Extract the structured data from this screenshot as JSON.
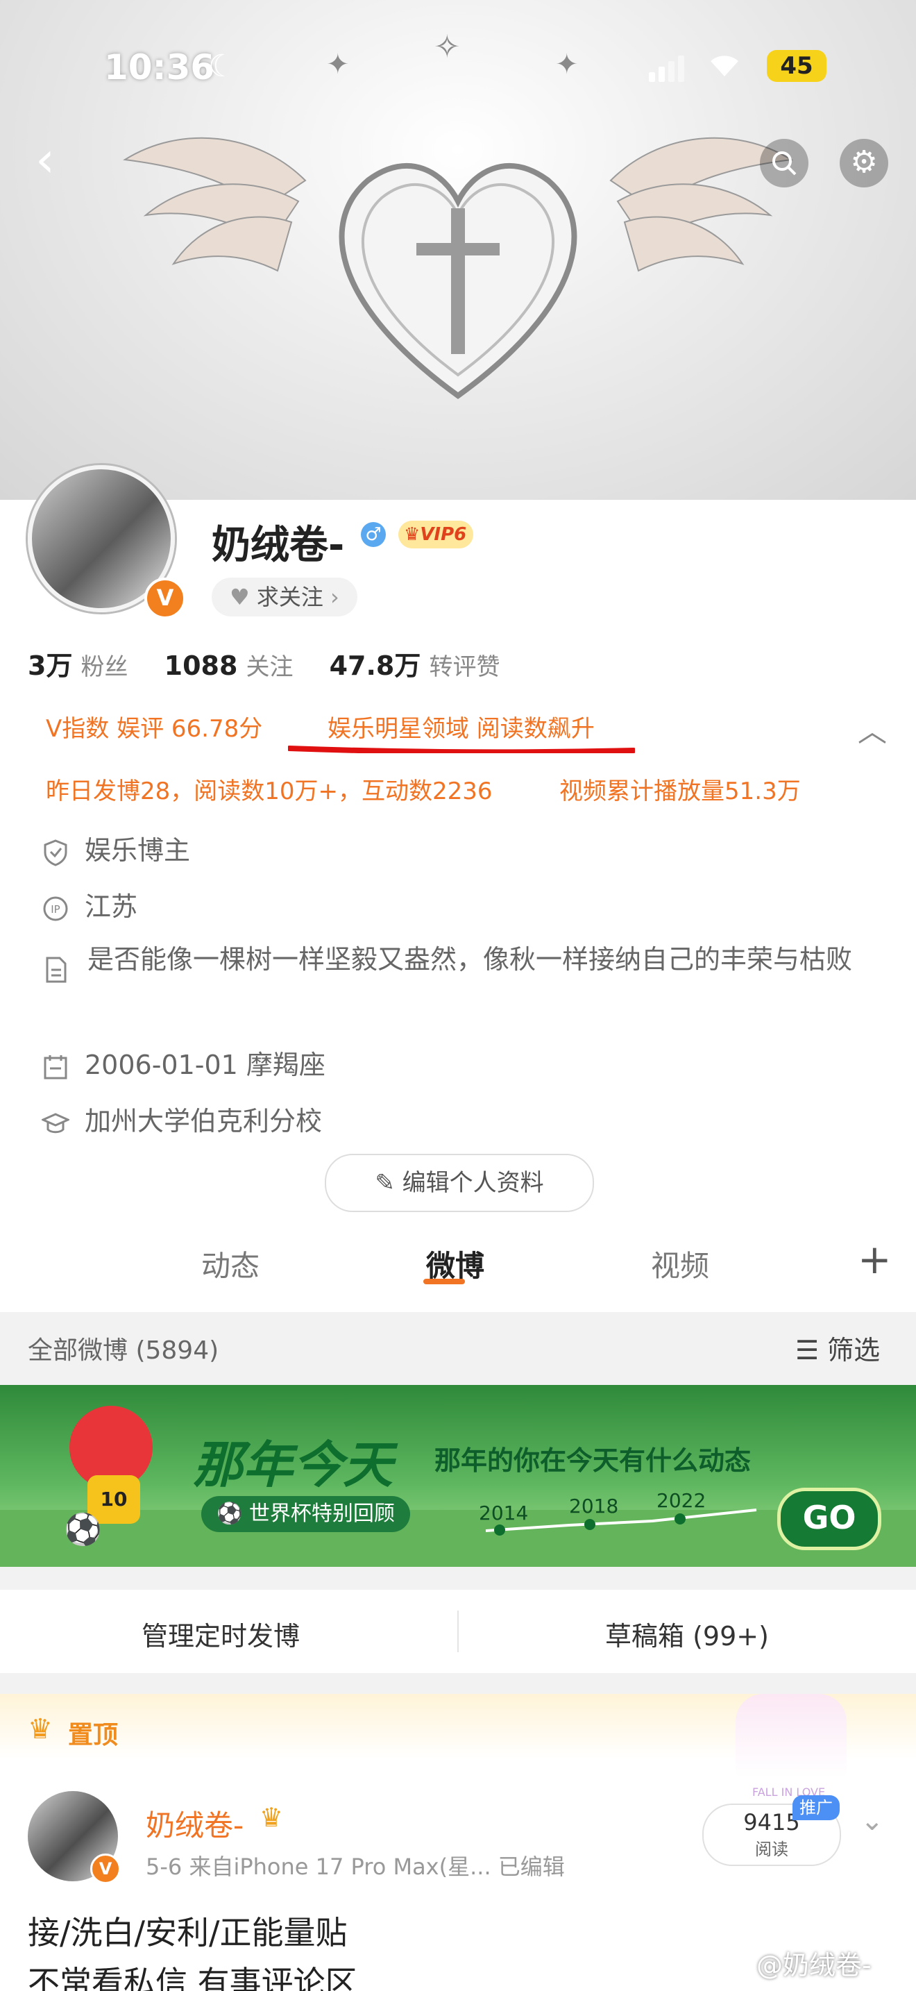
{
  "status_bar": {
    "time": "10:36",
    "battery": "45"
  },
  "profile": {
    "name": "奶绒卷-",
    "vip_label": "VIP6",
    "follow_label": "求关注",
    "stats": [
      {
        "value": "3万",
        "label": "粉丝"
      },
      {
        "value": "1088",
        "label": "关注"
      },
      {
        "value": "47.8万",
        "label": "转评赞"
      }
    ],
    "v_index": "V指数 娱评 66.78分",
    "domain_rise": "娱乐明星领域 阅读数飙升",
    "yesterday": "昨日发博28，阅读数10万+，互动数2236",
    "video_plays": "视频累计播放量51.3万",
    "category": "娱乐博主",
    "ip": "江苏",
    "bio": "是否能像一棵树一样坚毅又盎然，像秋一样接纳自己的丰荣与枯败",
    "birthday": "2006-01-01 摩羯座",
    "school": "加州大学伯克利分校",
    "edit_label": "编辑个人资料",
    "accent": "#f07423"
  },
  "tabs": [
    {
      "label": "动态"
    },
    {
      "label": "微博"
    },
    {
      "label": "视频"
    }
  ],
  "feed": {
    "all_label": "全部微博 (5894)",
    "filter_label": "筛选"
  },
  "promo": {
    "title": "那年今天",
    "subtitle": "那年的你在今天有什么动态",
    "tag": "世界杯特别回顾",
    "years": [
      "2014",
      "2018",
      "2022"
    ],
    "go_label": "GO",
    "mascot_number": "10"
  },
  "actions": {
    "scheduled": "管理定时发博",
    "drafts": "草稿箱 (99+)"
  },
  "pinned_post": {
    "pinned_label": "置顶",
    "author": "奶绒卷-",
    "meta_date": "5-6",
    "meta_source": "来自iPhone 17 Pro Max(星...",
    "edited": "已编辑",
    "reads_value": "9415",
    "reads_label": "阅读",
    "promo_badge": "推广",
    "deco_text": "FALL IN LOVE",
    "line1": "接/洗白/安利/正能量贴",
    "line2": "不常看私信 有事评论区"
  },
  "watermark": "@奶绒卷-"
}
